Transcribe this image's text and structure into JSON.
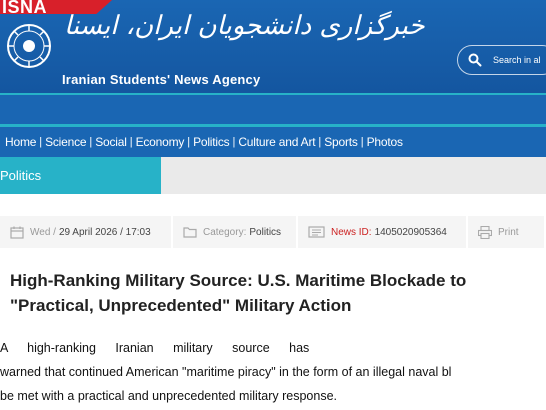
{
  "header": {
    "brand": "ISNA",
    "persian_title": "خبرگزاری دانشجویان ایران، ایسنا",
    "english_title": "Iranian Students' News Agency",
    "emblem_text": "جهاد دانشگاهی"
  },
  "search": {
    "placeholder": "Search in al"
  },
  "nav": {
    "items": [
      "Home",
      "Science",
      "Social",
      "Economy",
      "Politics",
      "Culture and Art",
      "Sports",
      "Photos"
    ],
    "separator": "|"
  },
  "section": {
    "label": "Politics"
  },
  "meta": {
    "day": "Wed /",
    "date": "29 April 2026 / 17:03",
    "category_label": "Category:",
    "category_value": "Politics",
    "news_id_label": "News ID:",
    "news_id_value": "1405020905364",
    "print_label": "Print"
  },
  "article": {
    "headline_line1": "High-Ranking Military Source: U.S. Maritime Blockade to",
    "headline_line2": "\"Practical, Unprecedented\" Military Action",
    "body_line1": "A high-ranking Iranian military source has",
    "body_line2": "warned that continued American \"maritime piracy\" in the form of an illegal naval bl",
    "body_line3": "be met with a practical and unprecedented military response."
  },
  "colors": {
    "header_blue": "#1a66b3",
    "accent_teal": "#27b2c8",
    "brand_red": "#d8202a",
    "news_id_red": "#cc2222"
  },
  "icons": [
    "isna-emblem-icon",
    "search-icon",
    "calendar-icon",
    "folder-icon",
    "news-id-icon",
    "print-icon"
  ]
}
